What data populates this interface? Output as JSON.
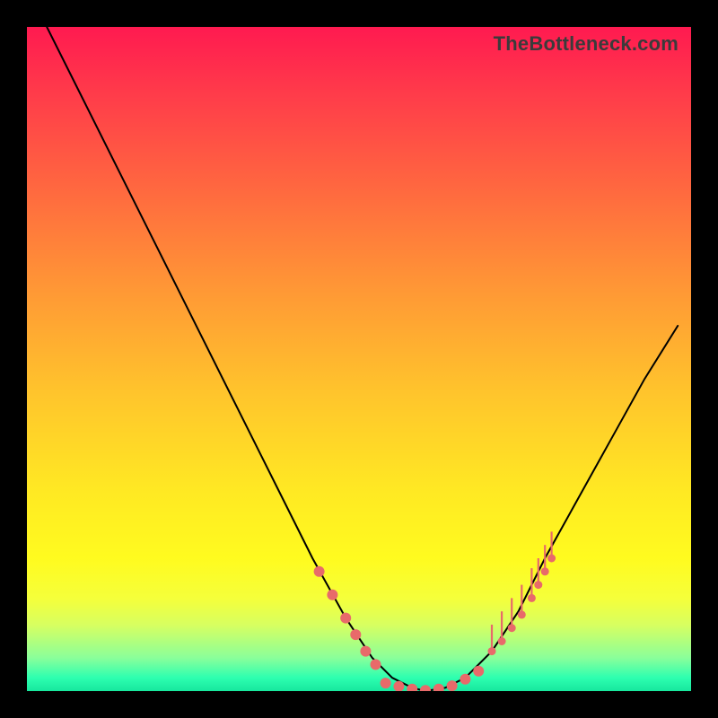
{
  "attribution": "TheBottleneck.com",
  "chart_data": {
    "type": "line",
    "title": "",
    "xlabel": "",
    "ylabel": "",
    "xlim": [
      0,
      100
    ],
    "ylim": [
      0,
      100
    ],
    "series": [
      {
        "name": "curve",
        "x": [
          3,
          8,
          14,
          20,
          26,
          32,
          38,
          43,
          48,
          52,
          55,
          58,
          60,
          63,
          66,
          70,
          74,
          78,
          83,
          88,
          93,
          98
        ],
        "y": [
          100,
          90,
          78,
          66,
          54,
          42,
          30,
          20,
          11,
          5,
          2,
          0.5,
          0,
          0.5,
          2,
          6,
          12,
          20,
          29,
          38,
          47,
          55
        ]
      }
    ],
    "markers": {
      "left_cluster": {
        "x": [
          44,
          46,
          48,
          49.5,
          51,
          52.5
        ],
        "y": [
          18,
          14.5,
          11,
          8.5,
          6,
          4
        ]
      },
      "floor_cluster": {
        "x": [
          54,
          56,
          58,
          60,
          62,
          64,
          66,
          68
        ],
        "y": [
          1.2,
          0.7,
          0.3,
          0.1,
          0.3,
          0.8,
          1.8,
          3
        ]
      },
      "ticks_cluster": {
        "x": [
          70,
          71.5,
          73,
          74.5,
          76,
          77,
          78,
          79
        ],
        "y0": [
          6,
          7.5,
          9.5,
          11.5,
          14,
          16,
          18,
          20
        ],
        "y1": [
          10,
          12,
          14,
          16,
          18.5,
          20,
          22,
          24
        ]
      }
    }
  }
}
